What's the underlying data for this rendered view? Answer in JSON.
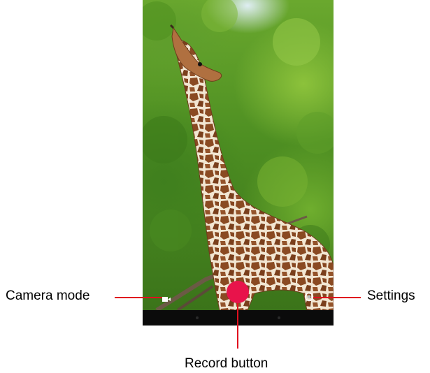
{
  "labels": {
    "camera_mode": "Camera mode",
    "settings": "Settings",
    "record_button": "Record button"
  },
  "icons": {
    "camera_mode": "video-camera-icon",
    "settings": "settings-ring-icon",
    "record": "record-circle-icon"
  },
  "colors": {
    "record": "#e8134b",
    "callout_line": "#e0101f",
    "navbar": "#0b0b0b"
  }
}
